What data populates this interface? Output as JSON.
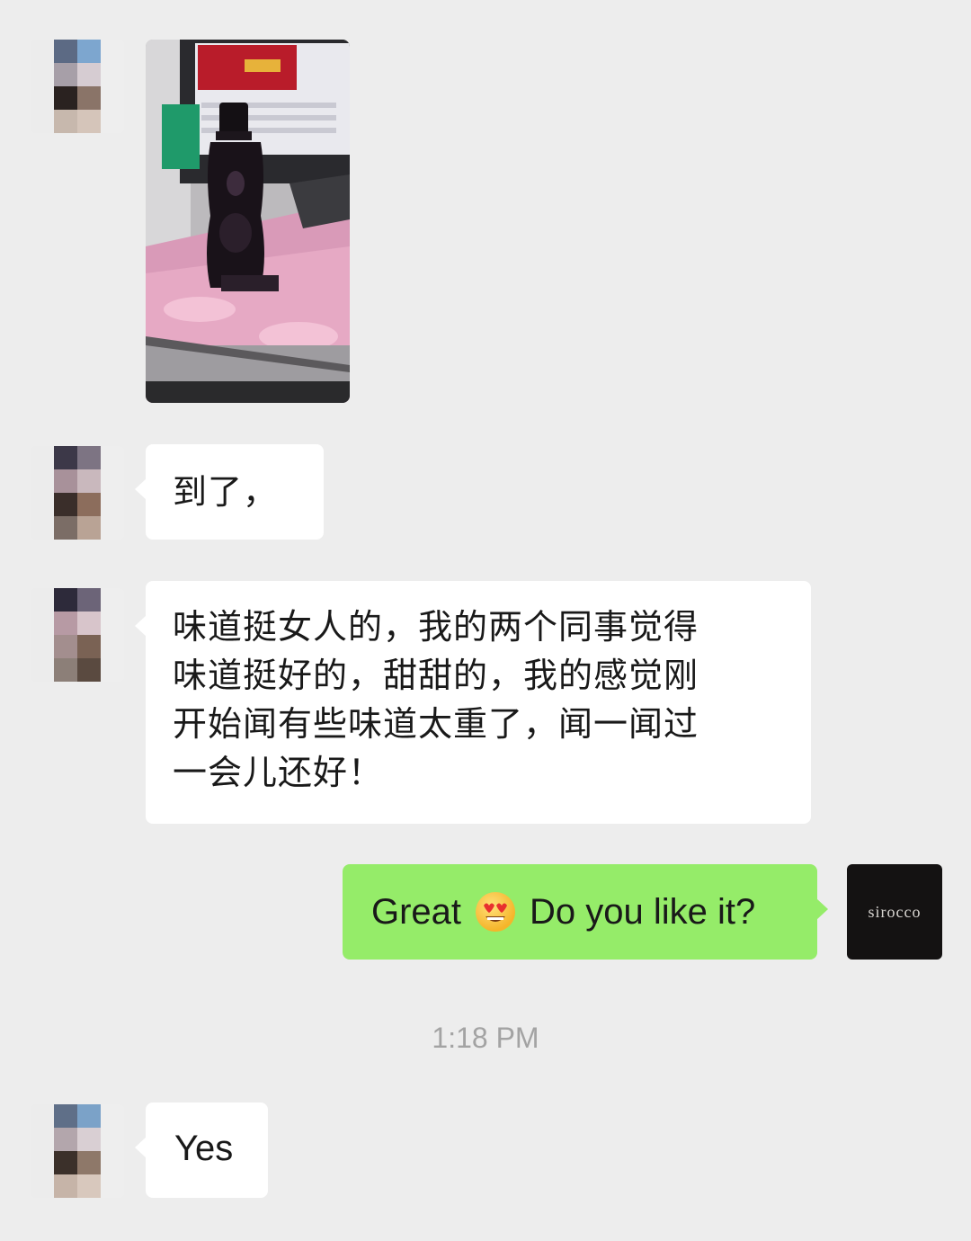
{
  "messages": {
    "m2": "到了，",
    "m3_lines": [
      "味道挺女人的，我的两个同事觉得",
      "味道挺好的，甜甜的，我的感觉刚",
      "开始闻有些味道太重了，闻一闻过",
      "一会儿还好！"
    ],
    "m4_before": "Great",
    "m4_after": "Do you like it?",
    "m5": "Yes"
  },
  "timestamp": "1:18 PM",
  "self_avatar_label": "sirocco",
  "icons": {
    "emoji": "heart-eyes-emoji",
    "photo": "perfume-bottle-photo"
  },
  "colors": {
    "background": "#ededed",
    "bubble_incoming": "#ffffff",
    "bubble_outgoing": "#95ec69"
  }
}
